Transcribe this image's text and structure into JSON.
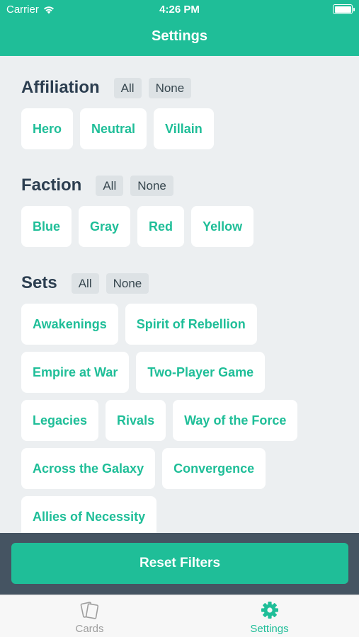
{
  "status_bar": {
    "carrier": "Carrier",
    "time": "4:26 PM"
  },
  "nav": {
    "title": "Settings"
  },
  "affiliation": {
    "title": "Affiliation",
    "all_label": "All",
    "none_label": "None",
    "options": [
      "Hero",
      "Neutral",
      "Villain"
    ]
  },
  "faction": {
    "title": "Faction",
    "all_label": "All",
    "none_label": "None",
    "options": [
      "Blue",
      "Gray",
      "Red",
      "Yellow"
    ]
  },
  "sets": {
    "title": "Sets",
    "all_label": "All",
    "none_label": "None",
    "options": [
      "Awakenings",
      "Spirit of Rebellion",
      "Empire at War",
      "Two-Player Game",
      "Legacies",
      "Rivals",
      "Way of the Force",
      "Across the Galaxy",
      "Convergence",
      "Allies of Necessity"
    ]
  },
  "reset_label": "Reset Filters",
  "tabs": [
    {
      "label": "Cards",
      "icon": "cards-icon",
      "active": false
    },
    {
      "label": "Settings",
      "icon": "gear-icon",
      "active": true
    }
  ],
  "colors": {
    "accent": "#1fbe98",
    "title_text": "#2c3e50",
    "background": "#eceff1",
    "reset_bar": "#455462"
  }
}
